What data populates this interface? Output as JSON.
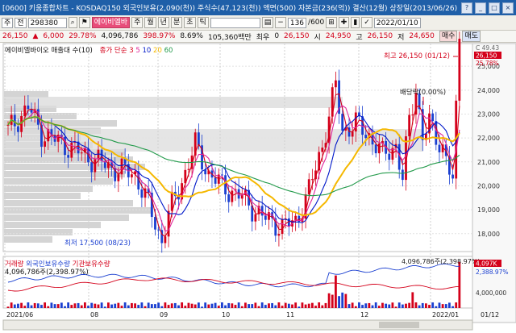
{
  "window": {
    "title": "[0600] 키움종합차트 - KOSDAQ150 외국인보유(2,090(천)) 주식수(47,123(천)) 액면(500) 자본금(236(억)) 결산(12월) 상장일(2013/06/26)",
    "buttons": [
      "?",
      "_",
      "□",
      "×"
    ]
  },
  "toolbar": {
    "market": "주",
    "price_type": "전",
    "code": "298380",
    "company": "에이비엘바",
    "periods": [
      "주",
      "월",
      "년",
      "분",
      "초",
      "틱"
    ],
    "count": "136",
    "total": "/600",
    "date": "2022/01/10"
  },
  "ticker": {
    "price": "26,150",
    "change": "6,000",
    "change_pct": "29.78%",
    "volume": "4,096,786",
    "volume_pct": "398.97%",
    "turnover": "8.69%",
    "amount": "105,360백만",
    "item": "최우",
    "v1": "0",
    "v2": "26,150",
    "open_label": "시",
    "open": "24,950",
    "high_label": "고",
    "high": "26,150",
    "low_label": "저",
    "low": "24,650",
    "buy_label": "매수",
    "sell_label": "매도"
  },
  "price_chart": {
    "legend_name": "에이비엘바이오 매출대 수(10)",
    "ma_label": "종가 단순",
    "ma_periods": [
      {
        "label": "3",
        "color": "#d4001a"
      },
      {
        "label": "5",
        "color": "#e0259a"
      },
      {
        "label": "10",
        "color": "#0018c9"
      },
      {
        "label": "20",
        "color": "#f5b800"
      },
      {
        "label": "60",
        "color": "#229a4a"
      }
    ],
    "annotation_high": "최고 26,150 (01/12)",
    "annotation_low": "최저 17,500 (08/23)",
    "annotation_dividend": "배당락(0.00%)",
    "axis_top_a": "C 49.43",
    "axis_top_b": "25,78%",
    "current_price_tag": "26,150",
    "yticks": [
      "25,000",
      "24,000",
      "23,000",
      "22,000",
      "21,000",
      "20,000",
      "19,000",
      "18,000"
    ]
  },
  "volume_chart": {
    "legend": [
      {
        "label": "거래량",
        "color": "#d4001a"
      },
      {
        "label": "외국인보유수량",
        "color": "#1a3fd0"
      },
      {
        "label": "기관보유수량",
        "color": "#d4001a"
      }
    ],
    "value_left": "4,096,786주(2,398.97%)",
    "value_right": "4,096,786주(2,398.97%)",
    "tag_red": "4,097K",
    "tag_blue": "2,388.97%",
    "ytick": "4,000,000"
  },
  "x_axis": {
    "labels": [
      "2021/06",
      "08",
      "09",
      "10",
      "11",
      "12",
      "2022/01",
      "01/12"
    ]
  },
  "colors": {
    "up": "#d4001a",
    "down": "#1a3fd0",
    "title_bar": "#1f5fa8"
  }
}
